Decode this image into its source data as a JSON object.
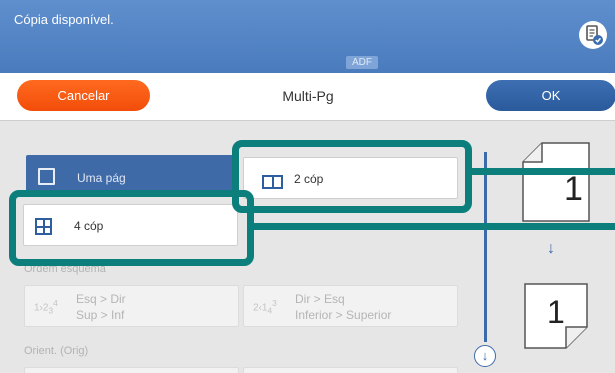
{
  "status": {
    "message": "Cópia disponível.",
    "adf_label": "ADF"
  },
  "header": {
    "cancel_label": "Cancelar",
    "title": "Multi-Pg",
    "ok_label": "OK"
  },
  "layout_options": {
    "one_page": "Uma pág",
    "two_up": "2 cóp",
    "four_up": "4 cóp"
  },
  "order_section": {
    "title": "Ordem esquema",
    "option1": {
      "line1": "Esq > Dir",
      "line2": "Sup > Inf"
    },
    "option2": {
      "line1": "Dir > Esq",
      "line2": "Inferior > Superior"
    }
  },
  "orient_section": {
    "title": "Orient. (Orig)"
  },
  "preview": {
    "page_number": "1"
  },
  "icons": {
    "doc_status": "document-check-icon",
    "scroll_down": "arrow-down-circle-icon",
    "flow_arrow": "arrow-down-icon"
  },
  "colors": {
    "status_bar": "#4a7bbd",
    "cancel": "#f24d0a",
    "ok": "#2a5a9c",
    "selected_option": "#3e6aa8",
    "callout": "#0c7f7c"
  }
}
